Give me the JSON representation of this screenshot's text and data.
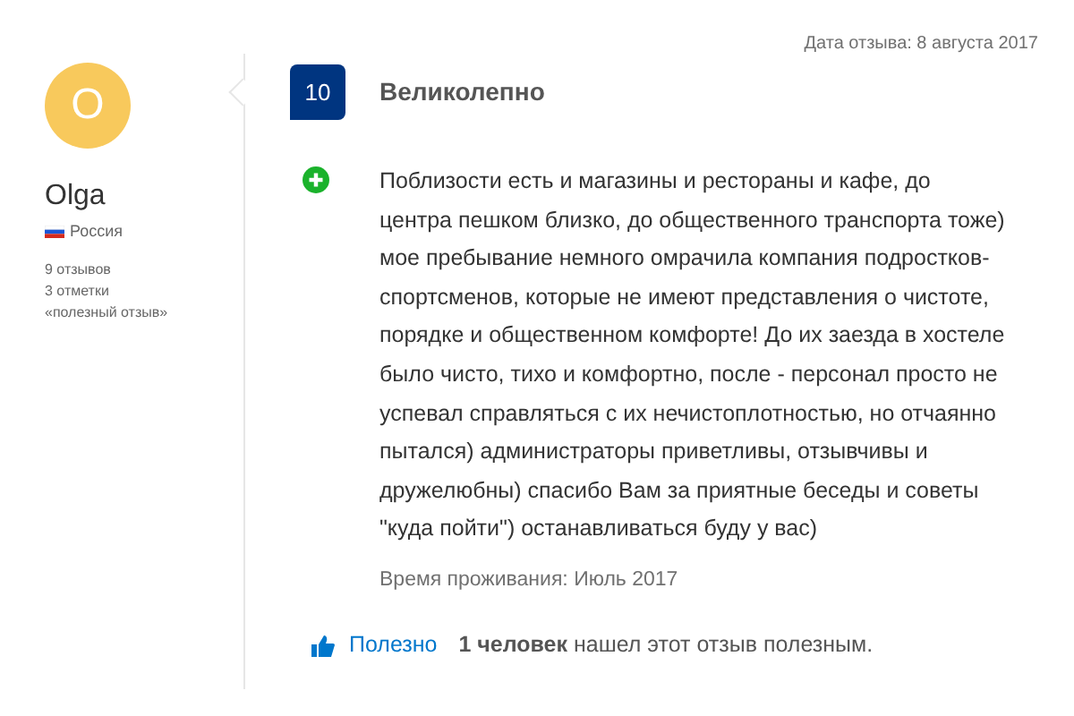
{
  "reviewer": {
    "initial": "O",
    "name": "Olga",
    "country": "Россия",
    "stats": [
      "9 отзывов",
      "3 отметки",
      "«полезный отзыв»"
    ]
  },
  "review": {
    "date": "Дата отзыва: 8 августа 2017",
    "score": "10",
    "title": "Великолепно",
    "positive": "Поблизости есть и магазины и рестораны и кафе, до центра пешком близко, до общественного транспорта тоже) мое пребывание немного омрачила компания подростков-спортсменов, которые не имеют представления о чистоте, порядке и общественном комфорте! До их заезда в хостеле было чисто, тихо и комфортно, после - персонал просто не успевал справляться с их нечистоплотностью, но отчаянно пытался) администраторы приветливы, отзывчивы и дружелюбны) спасибо Вам за приятные беседы и советы \"куда пойти\") останавливаться буду у вас)",
    "stay": "Время проживания: Июль 2017"
  },
  "helpful": {
    "button": "Полезно",
    "note": "**1 человек** нашел этот отзыв полезным."
  }
}
